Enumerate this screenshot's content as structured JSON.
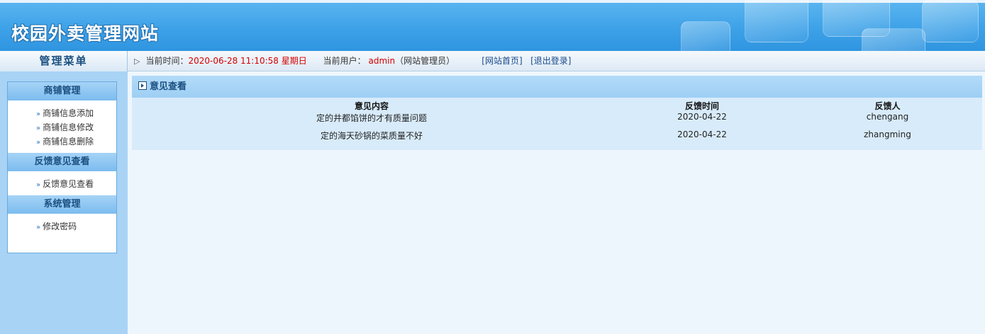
{
  "header": {
    "site_title": "校园外卖管理网站",
    "bg_color": "#3ea2e8"
  },
  "topbar": {
    "menu_title": "管理菜单",
    "time_label": "当前时间：",
    "time_value": "2020-06-28 11:10:58",
    "weekday": "星期日",
    "user_label": "当前用户：",
    "user_name": "admin",
    "user_role": "（网站管理员）",
    "home_link": "[网站首页]",
    "logout_link": "[退出登录]"
  },
  "sidebar": {
    "groups": [
      {
        "title": "商铺管理",
        "items": [
          "商铺信息添加",
          "商铺信息修改",
          "商铺信息删除"
        ]
      },
      {
        "title": "反馈意见查看",
        "items": [
          "反馈意见查看"
        ]
      },
      {
        "title": "系统管理",
        "items": [
          "修改密码"
        ]
      }
    ]
  },
  "main": {
    "panel_title": "意见查看",
    "columns": [
      "意见内容",
      "反馈时间",
      "反馈人"
    ],
    "rows": [
      {
        "content": "定的井都馅饼的才有质量问题",
        "time": "2020-04-22",
        "user": "chengang"
      },
      {
        "content": "定的海天砂锅的菜质量不好",
        "time": "2020-04-22",
        "user": "zhangming"
      }
    ]
  }
}
